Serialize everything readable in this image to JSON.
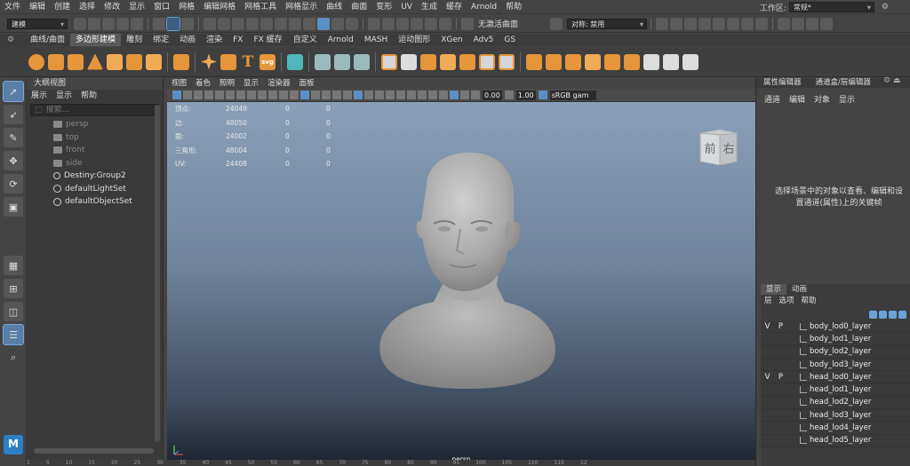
{
  "menubar": {
    "items": [
      "文件",
      "编辑",
      "创建",
      "选择",
      "修改",
      "显示",
      "窗口",
      "网格",
      "编辑网格",
      "网格工具",
      "网格显示",
      "曲线",
      "曲面",
      "变形",
      "UV",
      "生成",
      "缓存",
      "Arnold",
      "帮助"
    ],
    "workspace_label": "工作区:",
    "workspace_value": "常规*"
  },
  "statusline": {
    "mode_dropdown": "建模",
    "live_surface": "无激活曲面",
    "symmetry": "对称: 禁用"
  },
  "shelf": {
    "tabs": [
      "曲线/曲面",
      "多边形建模",
      "雕刻",
      "绑定",
      "动画",
      "渲染",
      "FX",
      "FX 缓存",
      "自定义",
      "Arnold",
      "MASH",
      "运动图形",
      "XGen",
      "Adv5",
      "GS"
    ],
    "active_tab": 1,
    "text_tool_glyph": "T",
    "svg_tool_label": "svg"
  },
  "outliner": {
    "title": "大纲视图",
    "menu": [
      "展示",
      "显示",
      "帮助"
    ],
    "search_placeholder": "搜索...",
    "items": [
      {
        "label": "persp",
        "type": "camera",
        "dim": true
      },
      {
        "label": "top",
        "type": "camera",
        "dim": true
      },
      {
        "label": "front",
        "type": "camera",
        "dim": true
      },
      {
        "label": "side",
        "type": "camera",
        "dim": true
      },
      {
        "label": "Destiny:Group2",
        "type": "group",
        "dim": false
      },
      {
        "label": "defaultLightSet",
        "type": "set",
        "dim": false
      },
      {
        "label": "defaultObjectSet",
        "type": "set",
        "dim": false
      }
    ]
  },
  "viewport": {
    "menu": [
      "视图",
      "着色",
      "照明",
      "显示",
      "渲染器",
      "面板"
    ],
    "exposure": "0.00",
    "gamma": "1.00",
    "color_space": "sRGB gam",
    "camera": "persp",
    "viewcube": {
      "front": "前",
      "right": "右"
    },
    "hud": [
      {
        "label": "顶点:",
        "v1": "24049",
        "v2": "0",
        "v3": "0"
      },
      {
        "label": "边:",
        "v1": "48050",
        "v2": "0",
        "v3": "0"
      },
      {
        "label": "面:",
        "v1": "24002",
        "v2": "0",
        "v3": "0"
      },
      {
        "label": "三角形:",
        "v1": "48004",
        "v2": "0",
        "v3": "0"
      },
      {
        "label": "UV:",
        "v1": "24408",
        "v2": "0",
        "v3": "0"
      }
    ]
  },
  "right_panel": {
    "tabs": [
      "属性编辑器",
      "通道盒/层编辑器"
    ],
    "menu": [
      "通道",
      "编辑",
      "对象",
      "显示"
    ],
    "hint": "选择场景中的对象以查看、编辑和设置通道(属性)上的关键帧"
  },
  "layers": {
    "tabs": [
      "显示",
      "动画"
    ],
    "menu": [
      "层",
      "选项",
      "帮助"
    ],
    "rows": [
      {
        "v": "V",
        "p": "P",
        "name": "body_lod0_layer"
      },
      {
        "v": "",
        "p": "",
        "name": "body_lod1_layer"
      },
      {
        "v": "",
        "p": "",
        "name": "body_lod2_layer"
      },
      {
        "v": "",
        "p": "",
        "name": "body_lod3_layer"
      },
      {
        "v": "V",
        "p": "P",
        "name": "head_lod0_layer"
      },
      {
        "v": "",
        "p": "",
        "name": "head_lod1_layer"
      },
      {
        "v": "",
        "p": "",
        "name": "head_lod2_layer"
      },
      {
        "v": "",
        "p": "",
        "name": "head_lod3_layer"
      },
      {
        "v": "",
        "p": "",
        "name": "head_lod4_layer"
      },
      {
        "v": "",
        "p": "",
        "name": "head_lod5_layer"
      }
    ]
  },
  "timeline": {
    "ticks": [
      "1",
      "5",
      "10",
      "15",
      "20",
      "25",
      "30",
      "35",
      "40",
      "45",
      "50",
      "55",
      "60",
      "65",
      "70",
      "75",
      "80",
      "85",
      "90",
      "95",
      "100",
      "105",
      "110",
      "115",
      "12"
    ]
  },
  "colors": {
    "accent": "#5c9cd8",
    "shelf_icon": "#e5953a",
    "ui_bg": "#444444"
  }
}
